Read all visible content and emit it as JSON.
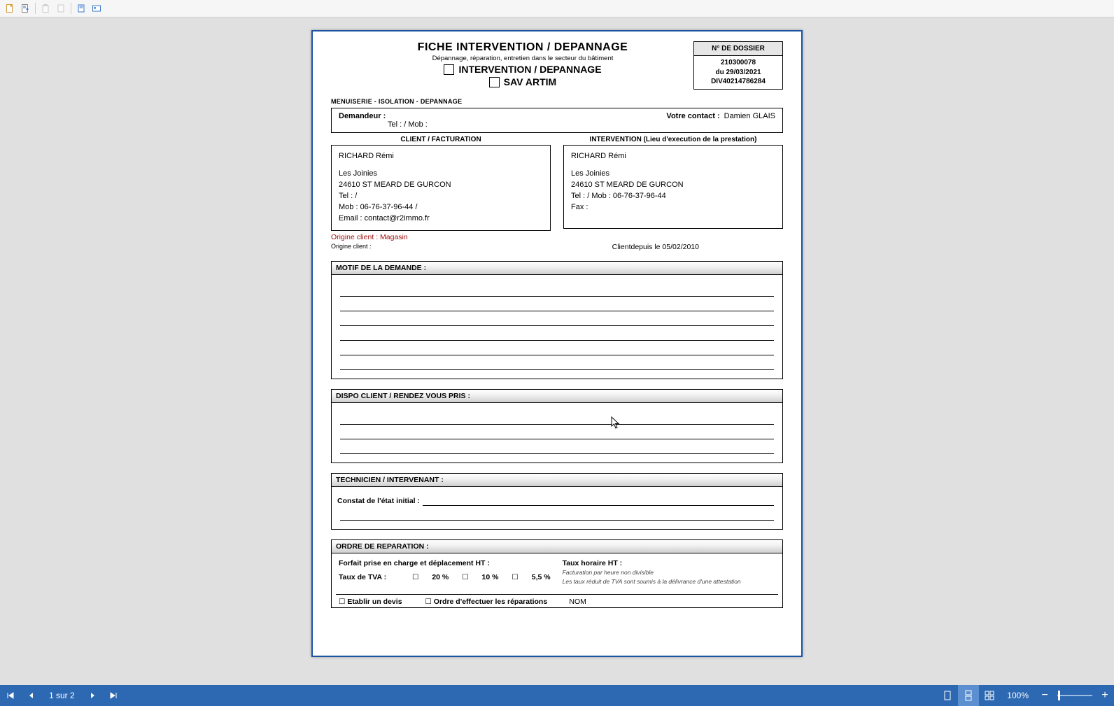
{
  "toolbar": {
    "icons": [
      "new-doc-icon",
      "export-icon",
      "clipboard-icon",
      "page-icon",
      "single-page-icon",
      "fit-width-icon"
    ]
  },
  "document": {
    "title": "FICHE INTERVENTION / DEPANNAGE",
    "subtitle": "Dépannage, réparation, entretien dans le secteur du bâtiment",
    "option1": "INTERVENTION / DEPANNAGE",
    "option2": "SAV ARTIM",
    "dossier": {
      "header": "N° DE DOSSIER",
      "number": "210300078",
      "date": "du 29/03/2021",
      "ref": "DIV40214786284"
    },
    "company_line": "MENUISERIE - ISOLATION - DEPANNAGE",
    "demandeur": {
      "label": "Demandeur :",
      "tel_label": "Tel :  /  Mob :",
      "contact_label": "Votre contact :",
      "contact_value": "Damien GLAIS"
    },
    "client_col": {
      "title": "CLIENT / FACTURATION",
      "name": "RICHARD Rémi",
      "addr1": "Les Joinies",
      "addr2": "24610 ST MEARD DE GURCON",
      "tel": "Tel :  /",
      "mob": "Mob : 06-76-37-96-44 /",
      "email": "Email : contact@r2immo.fr"
    },
    "interv_col": {
      "title": "INTERVENTION (Lieu d'execution de la prestation)",
      "name": "RICHARD Rémi",
      "addr1": "Les Joinies",
      "addr2": "24610 ST MEARD DE GURCON",
      "tel": "Tel :  / Mob : 06-76-37-96-44",
      "fax": "Fax :"
    },
    "origin": {
      "label": "Origine client :",
      "value": "Magasin",
      "sub_label": "Origine client :",
      "since": "Clientdepuis le 05/02/2010"
    },
    "sections": {
      "motif": "MOTIF DE LA DEMANDE :",
      "dispo": "DISPO CLIENT / RENDEZ VOUS PRIS :",
      "tech": "TECHNICIEN / INTERVENANT :",
      "constat": "Constat de l'état initial :",
      "ordre": "ORDRE DE REPARATION :"
    },
    "ordre": {
      "forfait": "Forfait prise en charge et déplacement HT :",
      "taux_horaire": "Taux horaire HT :",
      "tva_label": "Taux de TVA :",
      "tva_20": "20 %",
      "tva_10": "10 %",
      "tva_55": "5,5 %",
      "note1": "Facturation par heure non divisible",
      "note2": "Les taux réduit de TVA sont soumis à la délivrance d'une attestation",
      "devis": "Etablir un devis",
      "effectuer": "Ordre d'effectuer les réparations",
      "nom": "NOM"
    }
  },
  "footer": {
    "page_indicator": "1 sur 2",
    "zoom": "100%"
  }
}
